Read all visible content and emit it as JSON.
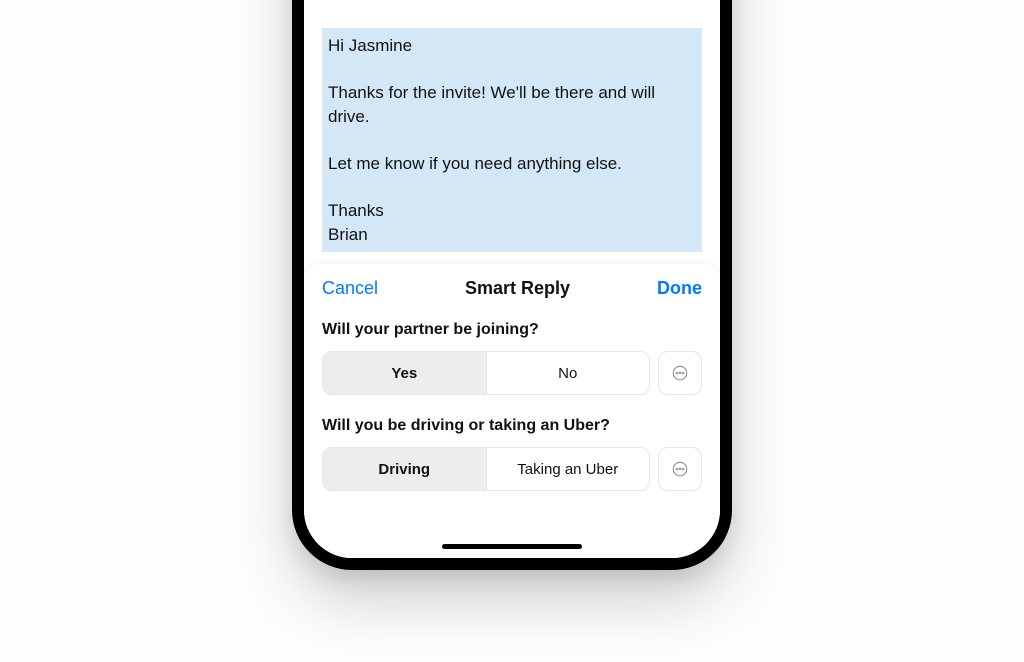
{
  "email": {
    "greeting": "Hi Jasmine",
    "body1": "Thanks for the invite! We'll be there and will drive.",
    "body2": "Let me know if you need anything else.",
    "signoff": "Thanks",
    "name": "Brian"
  },
  "sheet": {
    "cancel": "Cancel",
    "title": "Smart Reply",
    "done": "Done"
  },
  "questions": [
    {
      "prompt": "Will your partner be joining?",
      "options": [
        "Yes",
        "No"
      ],
      "selected": 0
    },
    {
      "prompt": "Will you be driving or taking an Uber?",
      "options": [
        "Driving",
        "Taking an Uber"
      ],
      "selected": 0
    }
  ]
}
